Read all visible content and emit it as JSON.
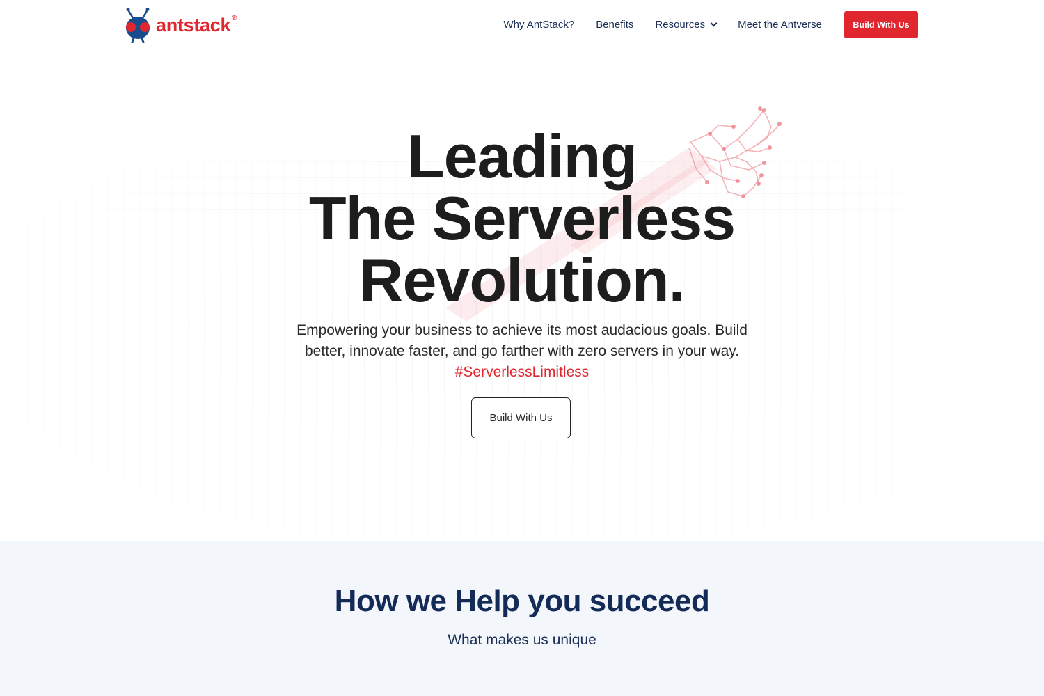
{
  "brand": {
    "name": "antstack",
    "reg_mark": "®",
    "colors": {
      "primary_red": "#e0262f",
      "navy": "#142b57",
      "ant_body": "#1a4b8c"
    }
  },
  "nav": {
    "items": [
      {
        "label": "Why AntStack?"
      },
      {
        "label": "Benefits"
      },
      {
        "label": "Resources",
        "icon": "chevron-down-icon"
      },
      {
        "label": "Meet the Antverse"
      }
    ],
    "cta_label": "Build With Us"
  },
  "hero": {
    "title_lines": [
      "Leading",
      "The Serverless",
      "Revolution."
    ],
    "subtitle": "Empowering your business to achieve its most audacious goals. Build better, innovate faster, and go farther with zero servers in your way.",
    "hashtag": "#ServerlessLimitless",
    "button_label": "Build With Us"
  },
  "help": {
    "title": "How we Help you succeed",
    "subtitle": "What makes us unique"
  }
}
